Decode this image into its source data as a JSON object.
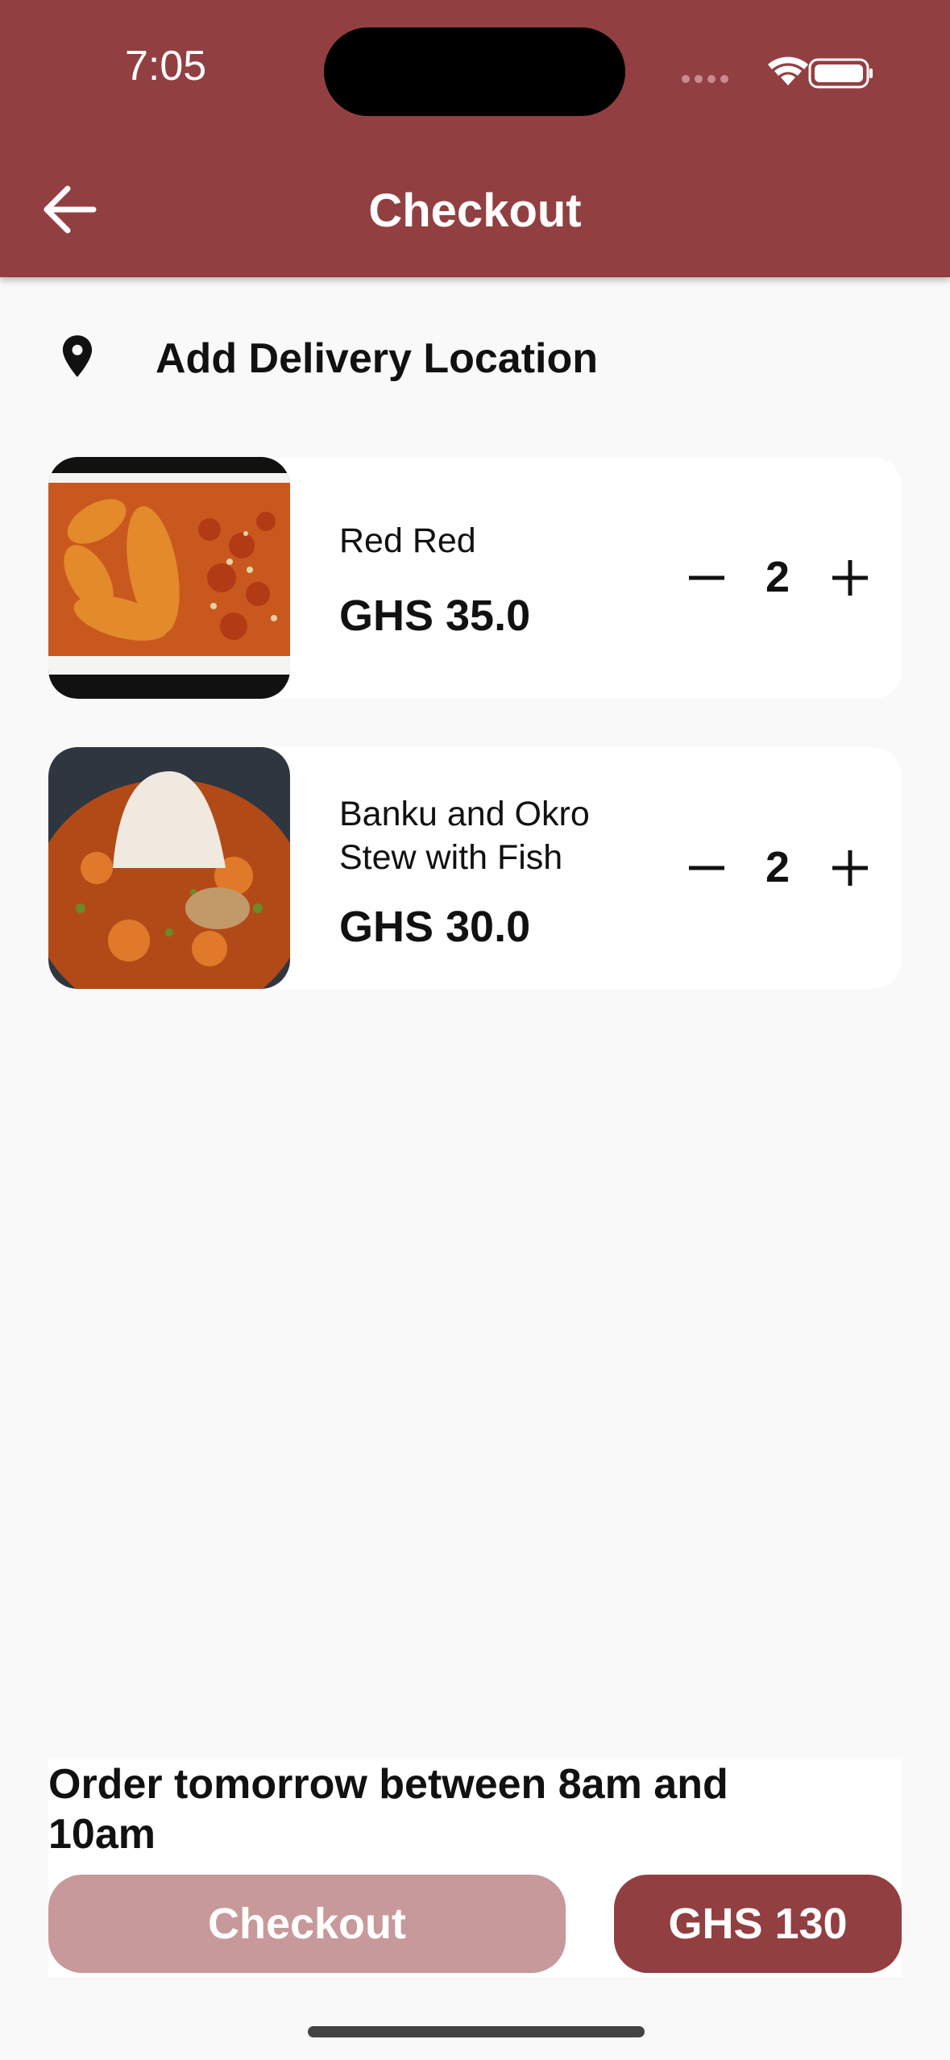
{
  "status_bar": {
    "time": "7:05"
  },
  "header": {
    "title": "Checkout"
  },
  "location": {
    "label": "Add Delivery Location"
  },
  "cart": {
    "items": [
      {
        "name": "Red Red",
        "price": "GHS 35.0",
        "quantity": "2"
      },
      {
        "name_line1": "Banku and Okro",
        "name_line2": "Stew with Fish",
        "price": "GHS 30.0",
        "quantity": "2"
      }
    ]
  },
  "footer": {
    "note_line1": "Order tomorrow between 8am and",
    "note_line2": "10am",
    "checkout_label": "Checkout",
    "total_label": "GHS 130"
  },
  "colors": {
    "brand": "#923f42",
    "brand_disabled": "#c8999a",
    "background": "#f9f9f9"
  },
  "icons": [
    "back-arrow-icon",
    "location-pin-icon",
    "minus-icon",
    "plus-icon",
    "wifi-icon",
    "battery-icon",
    "signal-icon"
  ]
}
